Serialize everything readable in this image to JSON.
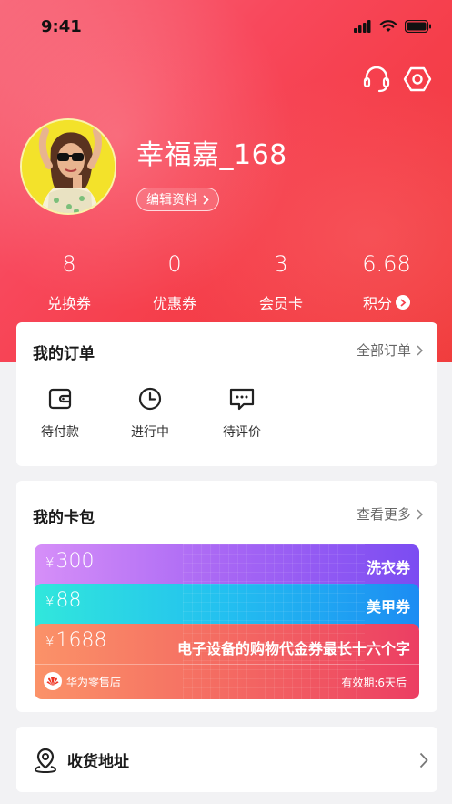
{
  "status": {
    "time": "9:41"
  },
  "profile": {
    "username": "幸福嘉_168",
    "edit_label": "编辑资料"
  },
  "stats": [
    {
      "value": "8",
      "label": "兑换券"
    },
    {
      "value": "0",
      "label": "优惠券"
    },
    {
      "value": "3",
      "label": "会员卡"
    },
    {
      "value": "6.68",
      "label": "积分"
    }
  ],
  "orders": {
    "title": "我的订单",
    "more": "全部订单",
    "items": [
      {
        "label": "待付款",
        "icon": "wallet-icon"
      },
      {
        "label": "进行中",
        "icon": "clock-icon"
      },
      {
        "label": "待评价",
        "icon": "comment-icon"
      }
    ]
  },
  "wallet": {
    "title": "我的卡包",
    "more": "查看更多",
    "coupons": [
      {
        "currency": "¥",
        "amount": "300",
        "name": "洗衣券"
      },
      {
        "currency": "¥",
        "amount": "88",
        "name": "美甲券"
      },
      {
        "currency": "¥",
        "amount": "1688",
        "name": "电子设备的购物代金券最长十六个字",
        "store": "华为零售店",
        "validity": "有效期:6天后"
      }
    ]
  },
  "address": {
    "label": "收货地址"
  },
  "colors": {
    "brand": "#f5404e",
    "coupon1_start": "#d58ef7",
    "coupon1_end": "#7b4cf2",
    "coupon2_start": "#2ee6e0",
    "coupon2_end": "#1e8ef2",
    "coupon3_start": "#fb8f6a",
    "coupon3_end": "#ee3f60"
  }
}
